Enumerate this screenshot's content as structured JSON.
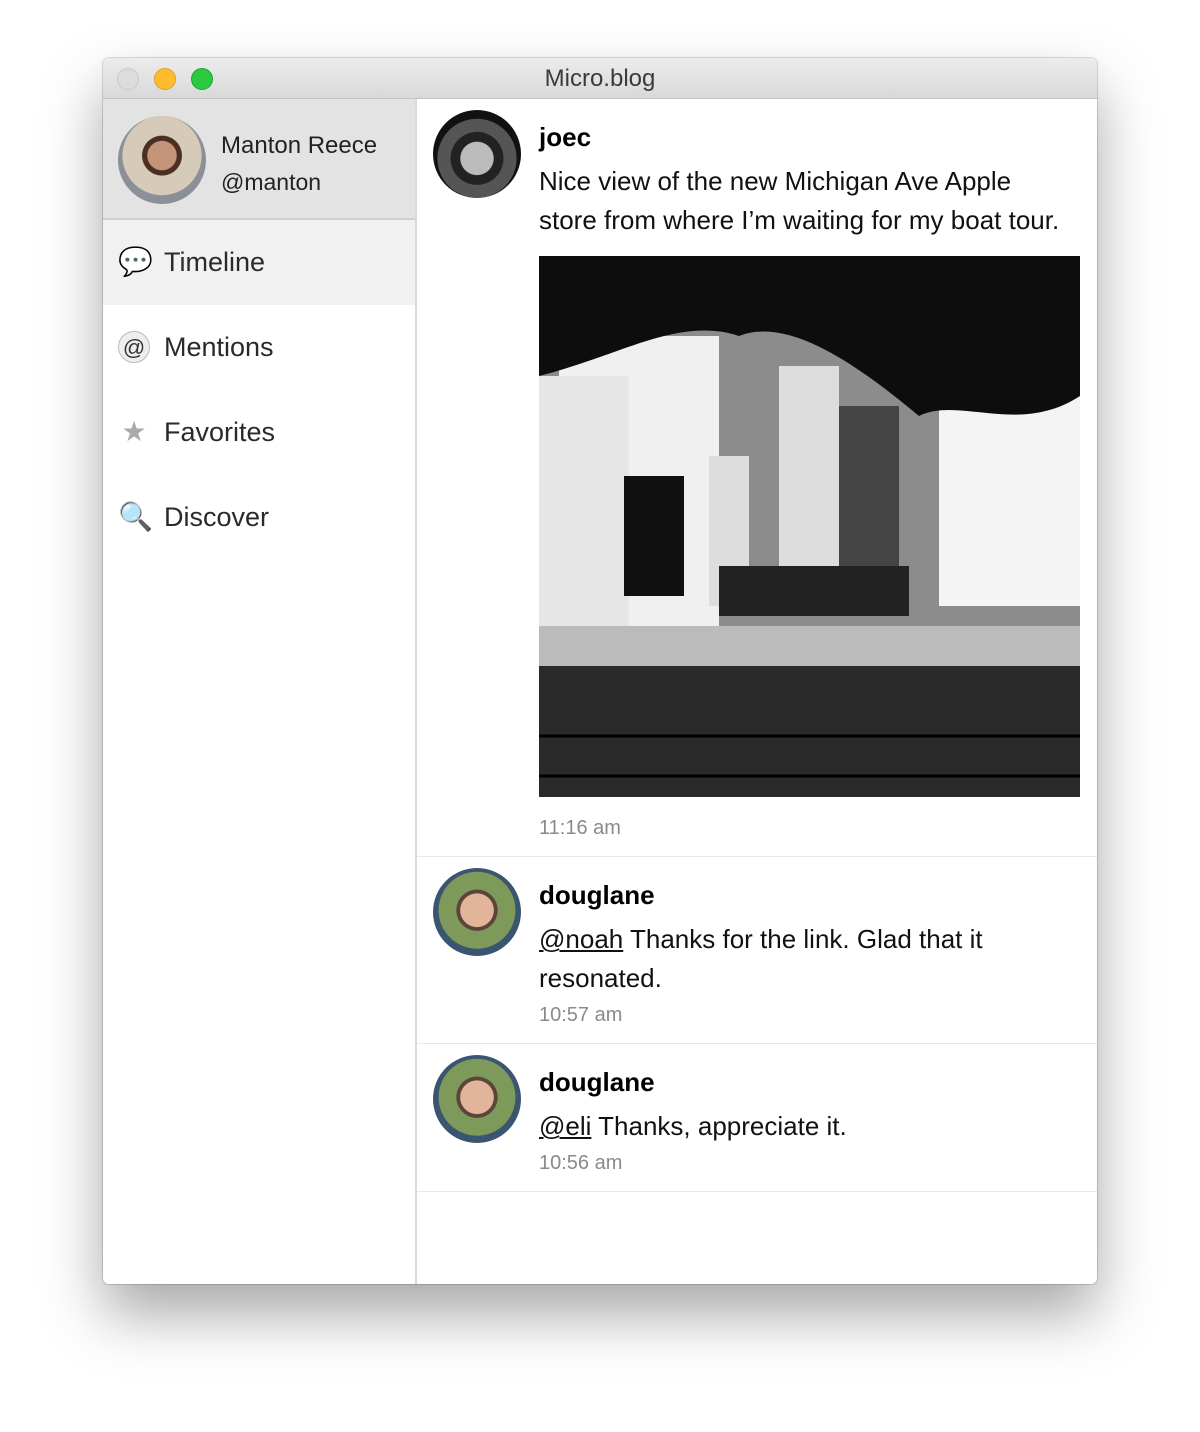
{
  "window": {
    "title": "Micro.blog"
  },
  "profile": {
    "name": "Manton Reece",
    "handle": "@manton"
  },
  "nav": [
    {
      "label": "Timeline",
      "icon": "speech-bubbles-icon",
      "selected": true
    },
    {
      "label": "Mentions",
      "icon": "at-bubble-icon"
    },
    {
      "label": "Favorites",
      "icon": "star-icon"
    },
    {
      "label": "Discover",
      "icon": "magnifier-icon"
    }
  ],
  "posts": [
    {
      "user": "joec",
      "text": "Nice view of the new Michigan Ave Apple store from where I’m waiting for my boat tour.",
      "time": "11:16 am",
      "has_photo": true
    },
    {
      "user": "douglane",
      "mention": "@noah",
      "text": " Thanks for the link. Glad that it resonated.",
      "time": "10:57 am"
    },
    {
      "user": "douglane",
      "mention": "@eli",
      "text": " Thanks, appreciate it.",
      "time": "10:56 am"
    }
  ]
}
